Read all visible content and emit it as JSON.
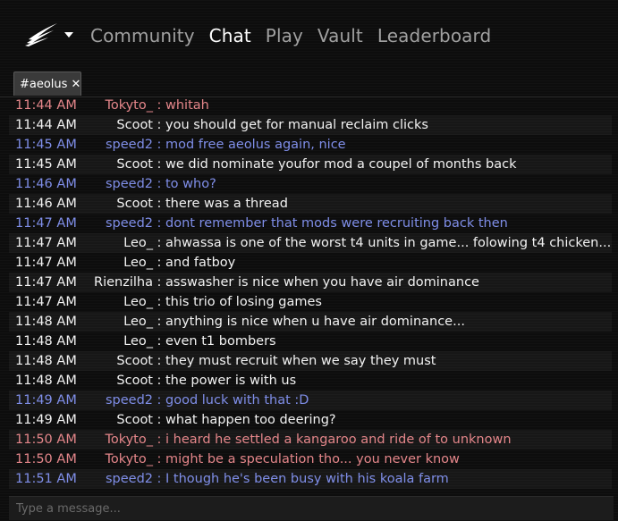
{
  "colors": {
    "self": "#f2f2f2",
    "tokyo": "#e4868a",
    "speed2": "#7f8ee8"
  },
  "logo": {
    "icon": "aeolus-wing-logo"
  },
  "nav": {
    "items": [
      {
        "label": "Community",
        "active": false
      },
      {
        "label": "Chat",
        "active": true
      },
      {
        "label": "Play",
        "active": false
      },
      {
        "label": "Vault",
        "active": false
      },
      {
        "label": "Leaderboard",
        "active": false
      }
    ]
  },
  "tabs": [
    {
      "label": "#aeolus",
      "close": "✕"
    }
  ],
  "separator": ":",
  "messages": [
    {
      "time": "11:44 AM",
      "nick": "Tokyto_",
      "text": "whitah",
      "color": "pink"
    },
    {
      "time": "11:44 AM",
      "nick": "Scoot",
      "text": "you should get for manual reclaim clicks",
      "color": "white"
    },
    {
      "time": "11:45 AM",
      "nick": "speed2",
      "text": "mod free aeolus again, nice",
      "color": "blue"
    },
    {
      "time": "11:45 AM",
      "nick": "Scoot",
      "text": "we did nominate youfor mod a coupel of months back",
      "color": "white"
    },
    {
      "time": "11:46 AM",
      "nick": "speed2",
      "text": "to who?",
      "color": "blue"
    },
    {
      "time": "11:46 AM",
      "nick": "Scoot",
      "text": "there was a thread",
      "color": "white"
    },
    {
      "time": "11:47 AM",
      "nick": "speed2",
      "text": "dont remember that mods were recruiting back then",
      "color": "blue"
    },
    {
      "time": "11:47 AM",
      "nick": "Leo_",
      "text": "ahwassa is one of the worst t4 units in game... folowing t4 chicken...",
      "color": "white"
    },
    {
      "time": "11:47 AM",
      "nick": "Leo_",
      "text": "and fatboy",
      "color": "white"
    },
    {
      "time": "11:47 AM",
      "nick": "Rienzilha",
      "text": "asswasher is nice when you have air dominance",
      "color": "white"
    },
    {
      "time": "11:47 AM",
      "nick": "Leo_",
      "text": "this trio of losing games",
      "color": "white"
    },
    {
      "time": "11:48 AM",
      "nick": "Leo_",
      "text": "anything is nice when u have air dominance...",
      "color": "white"
    },
    {
      "time": "11:48 AM",
      "nick": "Leo_",
      "text": "even t1 bombers",
      "color": "white"
    },
    {
      "time": "11:48 AM",
      "nick": "Scoot",
      "text": "they must recruit when we say they must",
      "color": "white"
    },
    {
      "time": "11:48 AM",
      "nick": "Scoot",
      "text": "the power is with us",
      "color": "white"
    },
    {
      "time": "11:49 AM",
      "nick": "speed2",
      "text": "good luck with that :D",
      "color": "blue"
    },
    {
      "time": "11:49 AM",
      "nick": "Scoot",
      "text": "what happen too deering?",
      "color": "white"
    },
    {
      "time": "11:50 AM",
      "nick": "Tokyto_",
      "text": "i heard he settled a kangaroo and ride of to unknown",
      "color": "pink"
    },
    {
      "time": "11:50 AM",
      "nick": "Tokyto_",
      "text": "might be a speculation tho... you never know",
      "color": "pink"
    },
    {
      "time": "11:51 AM",
      "nick": "speed2",
      "text": "I though he's been busy with his koala farm",
      "color": "blue"
    }
  ],
  "input": {
    "placeholder": "Type a message...",
    "value": ""
  }
}
